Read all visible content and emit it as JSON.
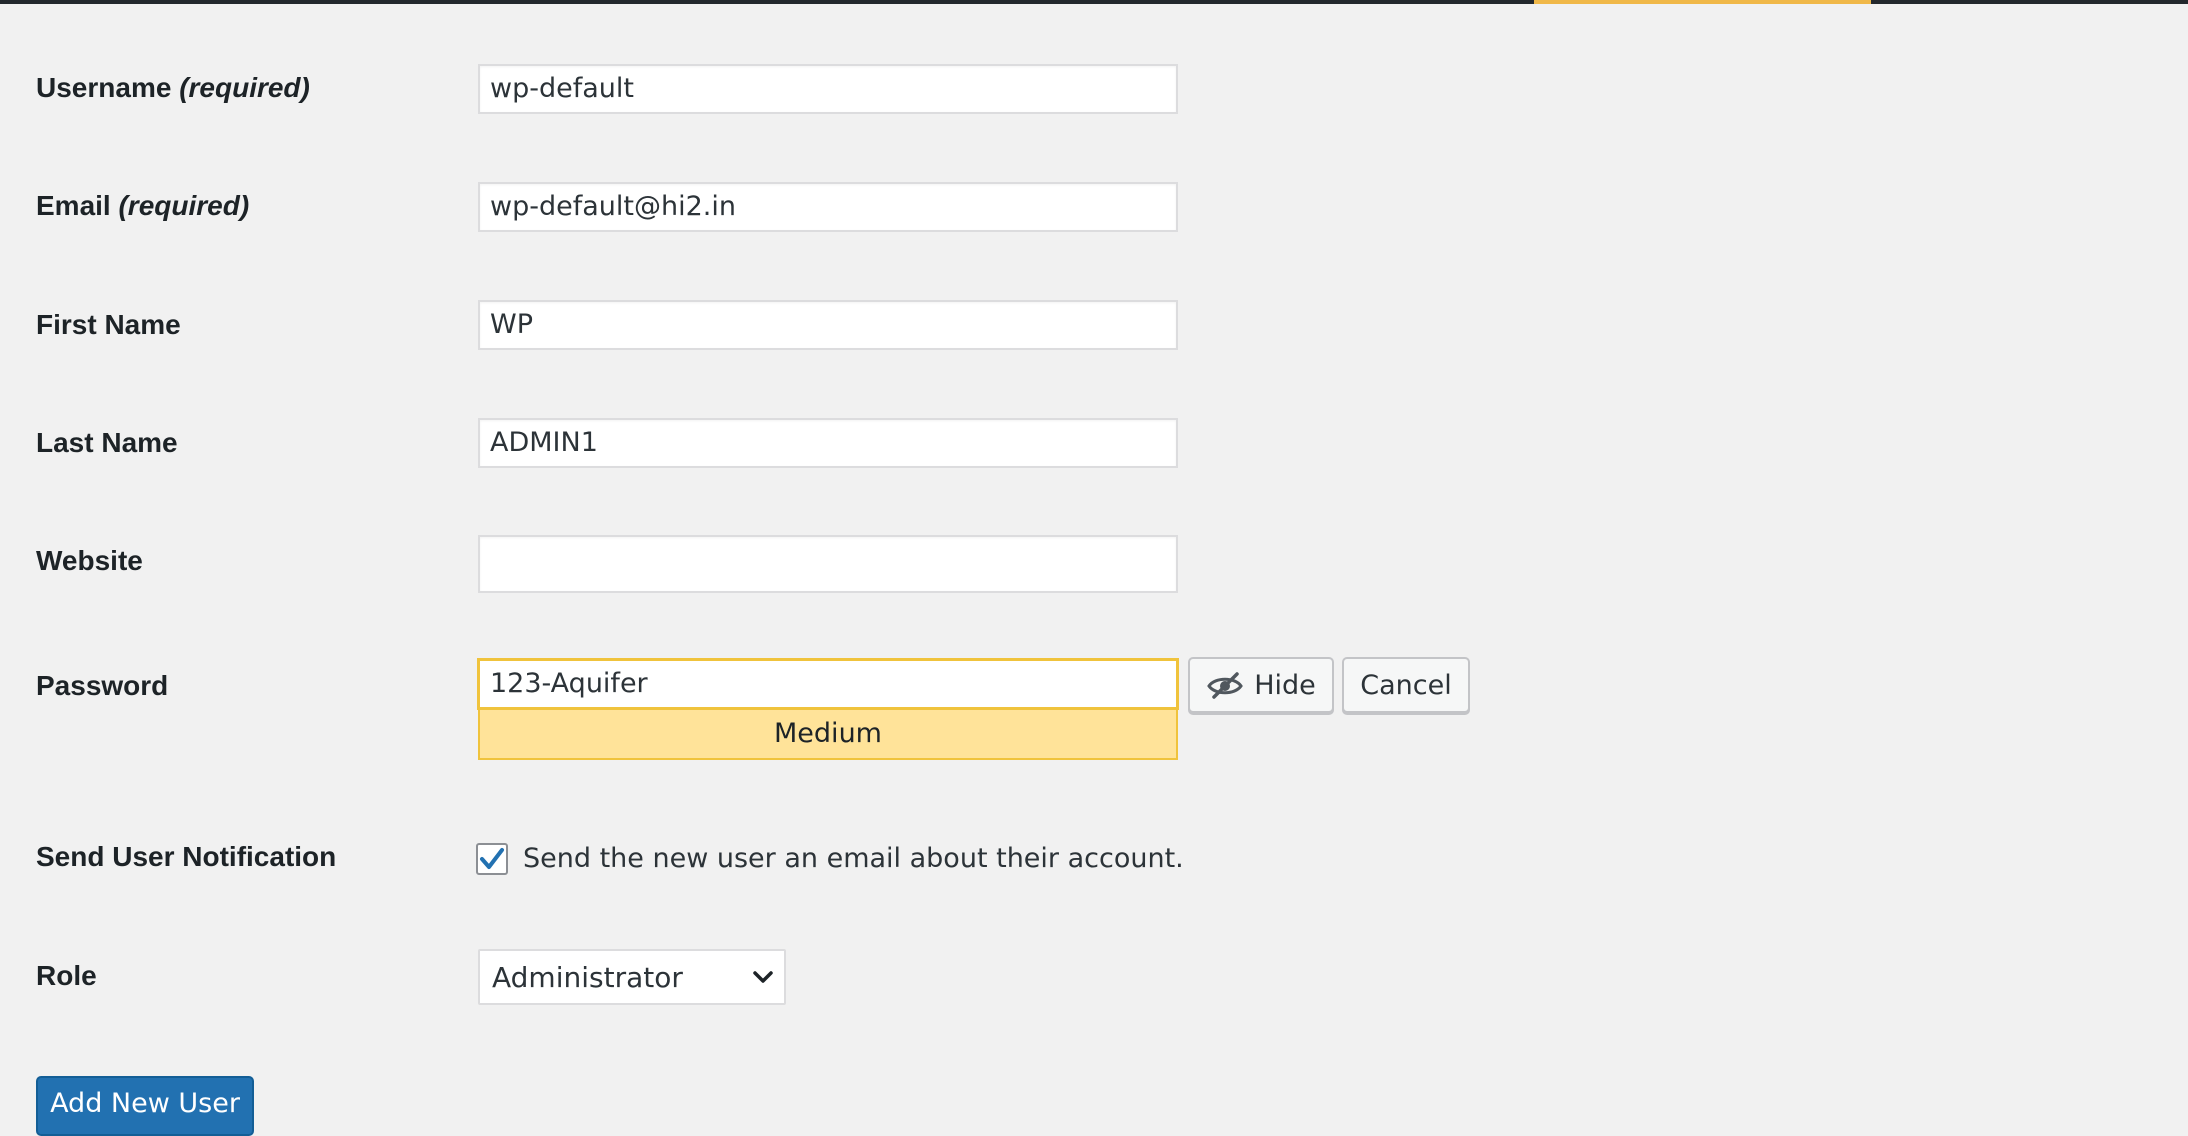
{
  "colors": {
    "accent": "#f0b849",
    "topbar": "#23282d",
    "primary": "#2271b1",
    "strength_medium_bg": "#ffe399",
    "strength_medium_border": "#f0c33c"
  },
  "form": {
    "username": {
      "label": "Username",
      "required": "(required)",
      "value": "wp-default"
    },
    "email": {
      "label": "Email",
      "required": "(required)",
      "value": "wp-default@hi2.in"
    },
    "first_name": {
      "label": "First Name",
      "value": "WP"
    },
    "last_name": {
      "label": "Last Name",
      "value": "ADMIN1"
    },
    "website": {
      "label": "Website",
      "value": ""
    },
    "password": {
      "label": "Password",
      "value": "123-Aquifer",
      "strength": "Medium",
      "hide_label": "Hide",
      "hide_icon": "eye-slash-icon",
      "cancel_label": "Cancel"
    },
    "notification": {
      "label": "Send User Notification",
      "checked": true,
      "checkbox_label": "Send the new user an email about their account."
    },
    "role": {
      "label": "Role",
      "selected": "Administrator"
    },
    "submit_label": "Add New User"
  }
}
